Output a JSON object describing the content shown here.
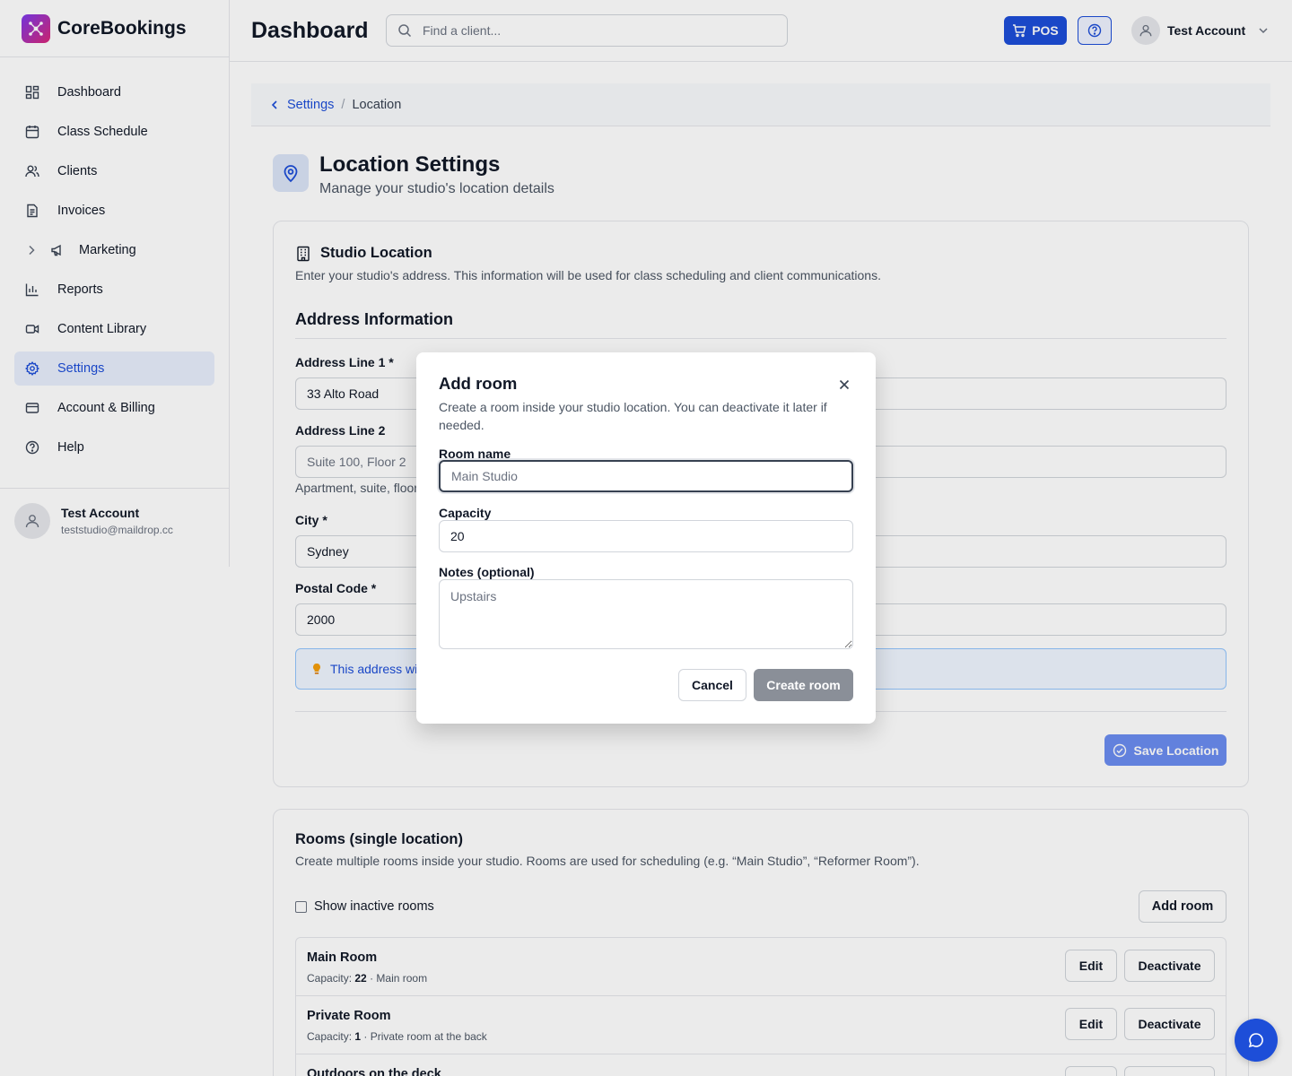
{
  "brand": {
    "name": "CoreBookings"
  },
  "sidebar": {
    "items": [
      {
        "label": "Dashboard",
        "icon": "dashboard-icon"
      },
      {
        "label": "Class Schedule",
        "icon": "calendar-icon"
      },
      {
        "label": "Clients",
        "icon": "users-icon"
      },
      {
        "label": "Invoices",
        "icon": "invoice-icon"
      },
      {
        "label": "Marketing",
        "icon": "megaphone-icon"
      },
      {
        "label": "Reports",
        "icon": "bar-chart-icon"
      },
      {
        "label": "Content Library",
        "icon": "video-icon"
      },
      {
        "label": "Settings",
        "icon": "gear-icon",
        "active": true
      },
      {
        "label": "Account & Billing",
        "icon": "credit-card-icon"
      },
      {
        "label": "Help",
        "icon": "help-circle-icon"
      }
    ],
    "user": {
      "name": "Test Account",
      "email": "teststudio@maildrop.cc"
    }
  },
  "topbar": {
    "title": "Dashboard",
    "search_placeholder": "Find a client...",
    "pos_label": "POS",
    "account_name": "Test Account"
  },
  "breadcrumb": {
    "parent": "Settings",
    "separator": "/",
    "current": "Location"
  },
  "page": {
    "title": "Location Settings",
    "subtitle": "Manage your studio's location details"
  },
  "location_card": {
    "title": "Studio Location",
    "description": "Enter your studio's address. This information will be used for class scheduling and client communications.",
    "section_title": "Address Information",
    "address1_label": "Address Line 1 *",
    "address1_value": "33 Alto Road",
    "address2_label": "Address Line 2",
    "address2_placeholder": "Suite 100, Floor 2",
    "address2_help": "Apartment, suite, floor",
    "city_label": "City *",
    "city_value": "Sydney",
    "postal_label": "Postal Code *",
    "postal_value": "2000",
    "info_text": "This address will",
    "save_label": "Save Location"
  },
  "rooms_card": {
    "title": "Rooms (single location)",
    "description": "Create multiple rooms inside your studio. Rooms are used for scheduling (e.g. “Main Studio”, “Reformer Room”).",
    "show_inactive_label": "Show inactive rooms",
    "add_room_label": "Add room",
    "capacity_prefix": "Capacity:",
    "edit_label": "Edit",
    "deactivate_label": "Deactivate",
    "rooms": [
      {
        "name": "Main Room",
        "capacity": "22",
        "note": "· Main room"
      },
      {
        "name": "Private Room",
        "capacity": "1",
        "note": "· Private room at the back"
      },
      {
        "name": "Outdoors on the deck",
        "capacity": "",
        "note": ""
      }
    ]
  },
  "modal": {
    "title": "Add room",
    "description": "Create a room inside your studio location. You can deactivate it later if needed.",
    "room_name_label": "Room name",
    "room_name_placeholder": "Main Studio",
    "capacity_label": "Capacity",
    "capacity_value": "20",
    "notes_label": "Notes (optional)",
    "notes_placeholder": "Upstairs",
    "cancel_label": "Cancel",
    "create_label": "Create room"
  },
  "colors": {
    "accent": "#1d4ed8",
    "brand_gradient_start": "#7c3aed",
    "brand_gradient_end": "#db2777",
    "create_button_disabled": "#8a8f98"
  }
}
